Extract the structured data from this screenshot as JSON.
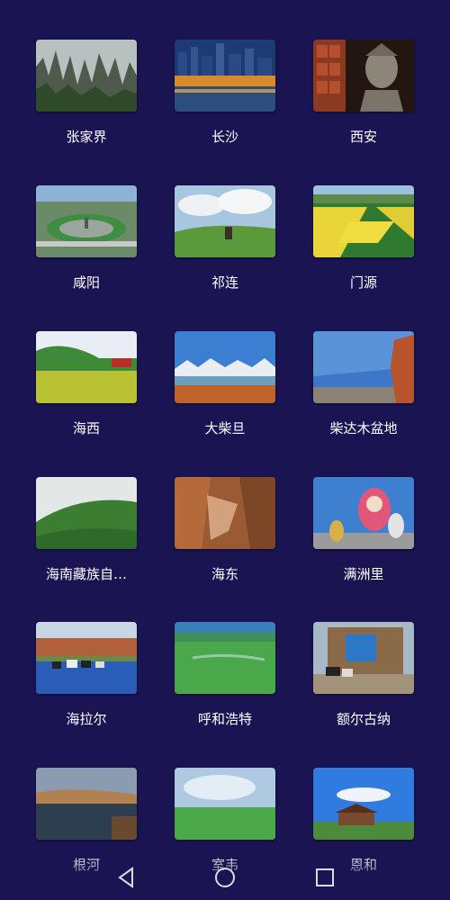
{
  "places": [
    {
      "label": "张家界",
      "icon": "zhangjiajie-photo"
    },
    {
      "label": "长沙",
      "icon": "changsha-night-photo"
    },
    {
      "label": "西安",
      "icon": "terracotta-warrior-photo"
    },
    {
      "label": "咸阳",
      "icon": "xianyang-aerial-photo"
    },
    {
      "label": "祁连",
      "icon": "qilian-grassland-photo"
    },
    {
      "label": "门源",
      "icon": "menyuan-rapeseed-photo"
    },
    {
      "label": "海西",
      "icon": "haixi-field-photo"
    },
    {
      "label": "大柴旦",
      "icon": "dachaidan-lake-photo"
    },
    {
      "label": "柴达木盆地",
      "icon": "qaidam-basin-photo"
    },
    {
      "label": "海南藏族自…",
      "icon": "hainan-mountain-photo"
    },
    {
      "label": "海东",
      "icon": "haidong-canyon-photo"
    },
    {
      "label": "满洲里",
      "icon": "manzhouli-matryoshka-photo"
    },
    {
      "label": "海拉尔",
      "icon": "hailar-cattle-river-photo"
    },
    {
      "label": "呼和浩特",
      "icon": "hohhot-grassland-photo"
    },
    {
      "label": "额尔古纳",
      "icon": "erguna-log-cabin-photo"
    },
    {
      "label": "根河",
      "icon": "genhe-river-photo"
    },
    {
      "label": "室韦",
      "icon": "shiwei-meadow-photo"
    },
    {
      "label": "恩和",
      "icon": "enhe-village-photo"
    }
  ],
  "navbar": {
    "back_icon": "triangle-back-icon",
    "home_icon": "circle-home-icon",
    "recents_icon": "square-recents-icon"
  },
  "colors": {
    "background": "#1a1452",
    "label_text": "#ffffff"
  }
}
